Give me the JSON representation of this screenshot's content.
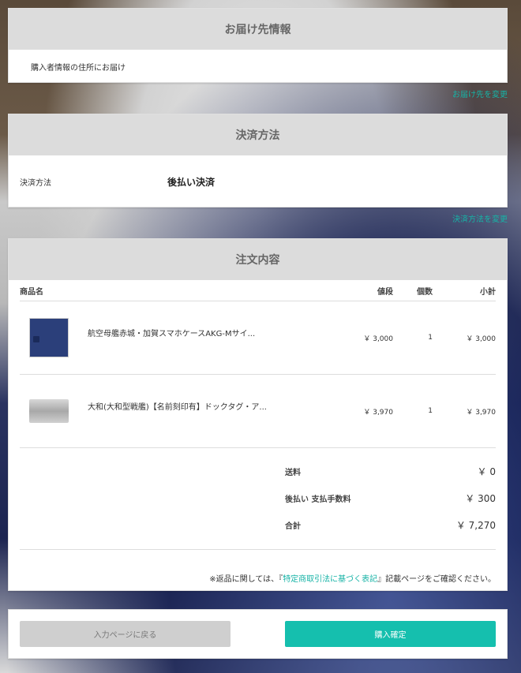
{
  "address": {
    "title": "お届け先情報",
    "text": "購入者情報の住所にお届け",
    "change_link": "お届け先を変更"
  },
  "payment": {
    "title": "決済方法",
    "label": "決済方法",
    "value": "後払い決済",
    "change_link": "決済方法を変更"
  },
  "order": {
    "title": "注文内容",
    "headers": {
      "name": "商品名",
      "price": "値段",
      "qty": "個数",
      "subtotal": "小計"
    },
    "items": [
      {
        "name": "航空母艦赤城・加賀スマホケースAKG-Mサイ...",
        "price": "￥ 3,000",
        "qty": "1",
        "subtotal": "￥ 3,000",
        "image_icon": "phone-case-image"
      },
      {
        "name": "大和(大和型戦艦)【名前刻印有】ドックタグ・ア...",
        "price": "￥ 3,970",
        "qty": "1",
        "subtotal": "￥ 3,970",
        "image_icon": "dog-tag-image"
      }
    ],
    "totals": [
      {
        "label": "送料",
        "value": "￥ 0"
      },
      {
        "label": "後払い 支払手数料",
        "value": "￥ 300"
      },
      {
        "label": "合計",
        "value": "￥ 7,270"
      }
    ],
    "note_prefix": "※返品に関しては、『",
    "note_link": "特定商取引法に基づく表記",
    "note_suffix": "』記載ページをご確認ください。"
  },
  "buttons": {
    "back": "入力ページに戻る",
    "confirm": "購入確定"
  },
  "colors": {
    "accent": "#16b3a6",
    "confirm_button": "#15bfae",
    "header_bg": "#dcdcdc"
  }
}
